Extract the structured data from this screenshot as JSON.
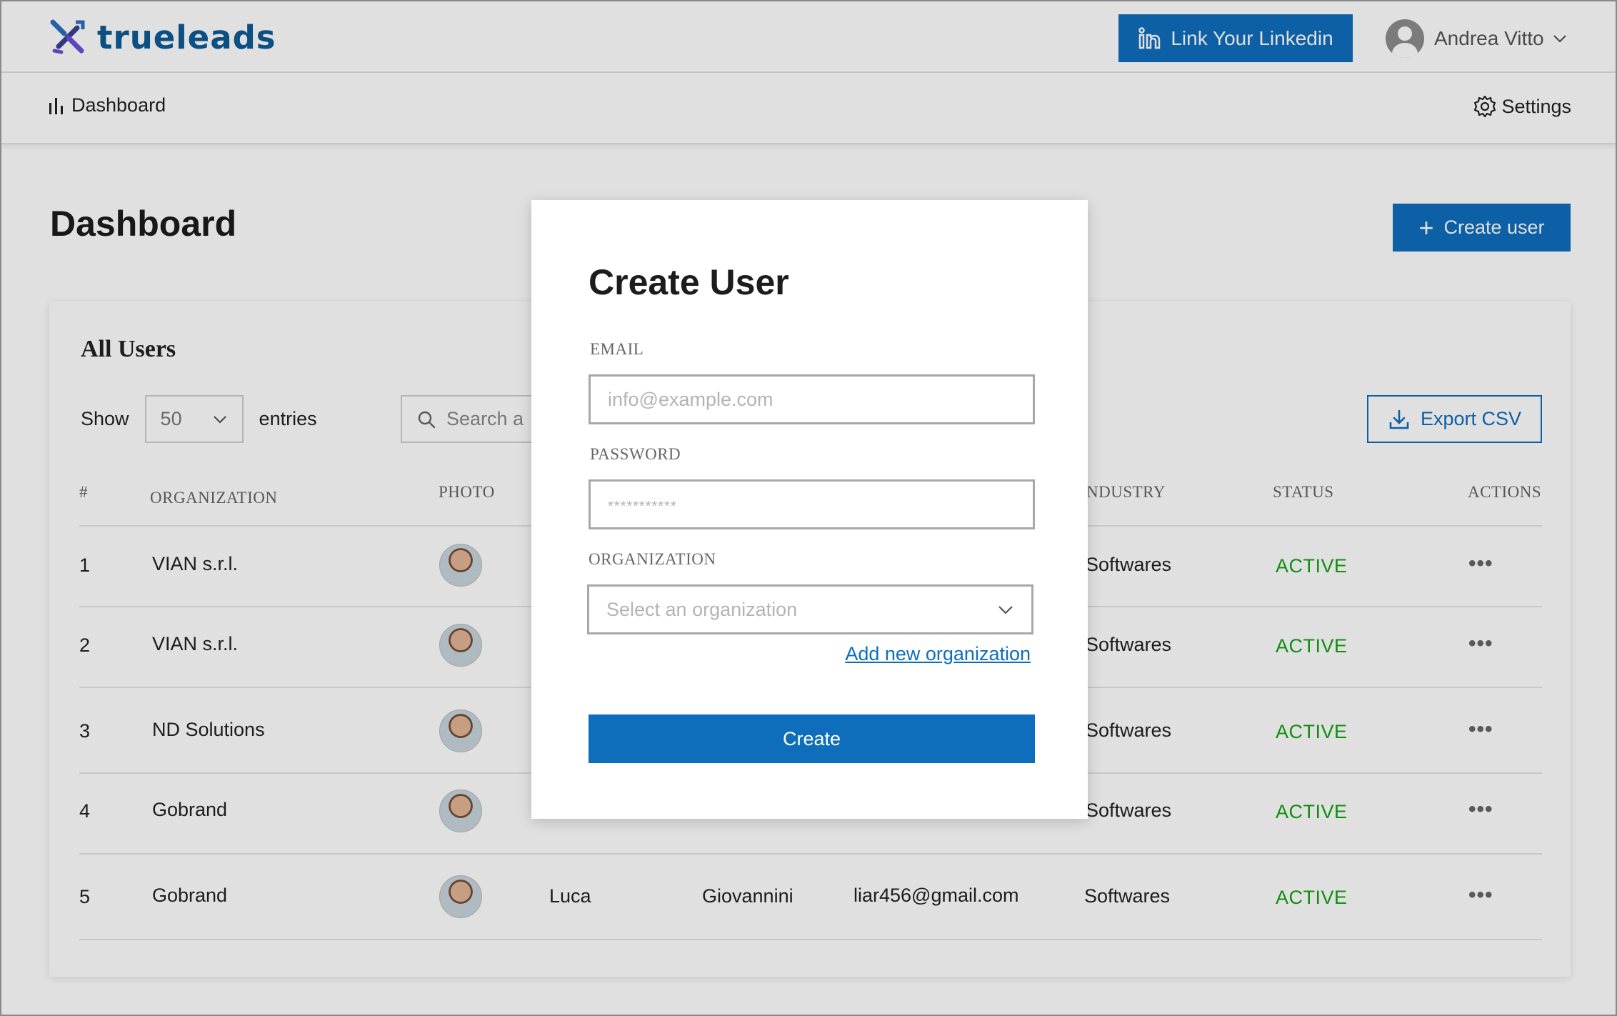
{
  "header": {
    "logo_text": "trueleads",
    "linkedin_button": "Link Your Linkedin",
    "user_name": "Andrea Vitto"
  },
  "nav": {
    "dashboard": "Dashboard",
    "settings": "Settings"
  },
  "page": {
    "title": "Dashboard",
    "create_user_button": "Create user"
  },
  "users_card": {
    "title": "All Users",
    "show_label": "Show",
    "entries_value": "50",
    "entries_label": "entries",
    "search_placeholder": "Search a",
    "export_button": "Export CSV",
    "columns": {
      "index": "#",
      "organization": "ORGANIZATION",
      "photo": "PHOTO",
      "industry": "NDUSTRY",
      "status": "STATUS",
      "actions": "ACTIONS"
    },
    "rows": [
      {
        "index": "1",
        "organization": "VIAN s.r.l.",
        "industry": "Softwares",
        "status": "ACTIVE",
        "first_name": "",
        "last_name": "",
        "email": ""
      },
      {
        "index": "2",
        "organization": "VIAN s.r.l.",
        "industry": "Softwares",
        "status": "ACTIVE",
        "first_name": "",
        "last_name": "",
        "email": ""
      },
      {
        "index": "3",
        "organization": "ND Solutions",
        "industry": "Softwares",
        "status": "ACTIVE",
        "first_name": "",
        "last_name": "",
        "email": ""
      },
      {
        "index": "4",
        "organization": "Gobrand",
        "industry": "Softwares",
        "status": "ACTIVE",
        "first_name": "",
        "last_name": "",
        "email": ""
      },
      {
        "index": "5",
        "organization": "Gobrand",
        "industry": "Softwares",
        "status": "ACTIVE",
        "first_name": "Luca",
        "last_name": "Giovannini",
        "email": "liar456@gmail.com"
      }
    ],
    "actions_glyph": "•••"
  },
  "modal": {
    "title": "Create User",
    "email_label": "EMAIL",
    "email_placeholder": "info@example.com",
    "password_label": "PASSWORD",
    "password_placeholder": "***********",
    "organization_label": "ORGANIZATION",
    "organization_placeholder": "Select an organization",
    "add_organization_link": "Add new organization",
    "submit_button": "Create"
  },
  "colors": {
    "primary": "#0f6ebc",
    "status_active": "#12a312",
    "logo_text": "#0e5a96"
  }
}
